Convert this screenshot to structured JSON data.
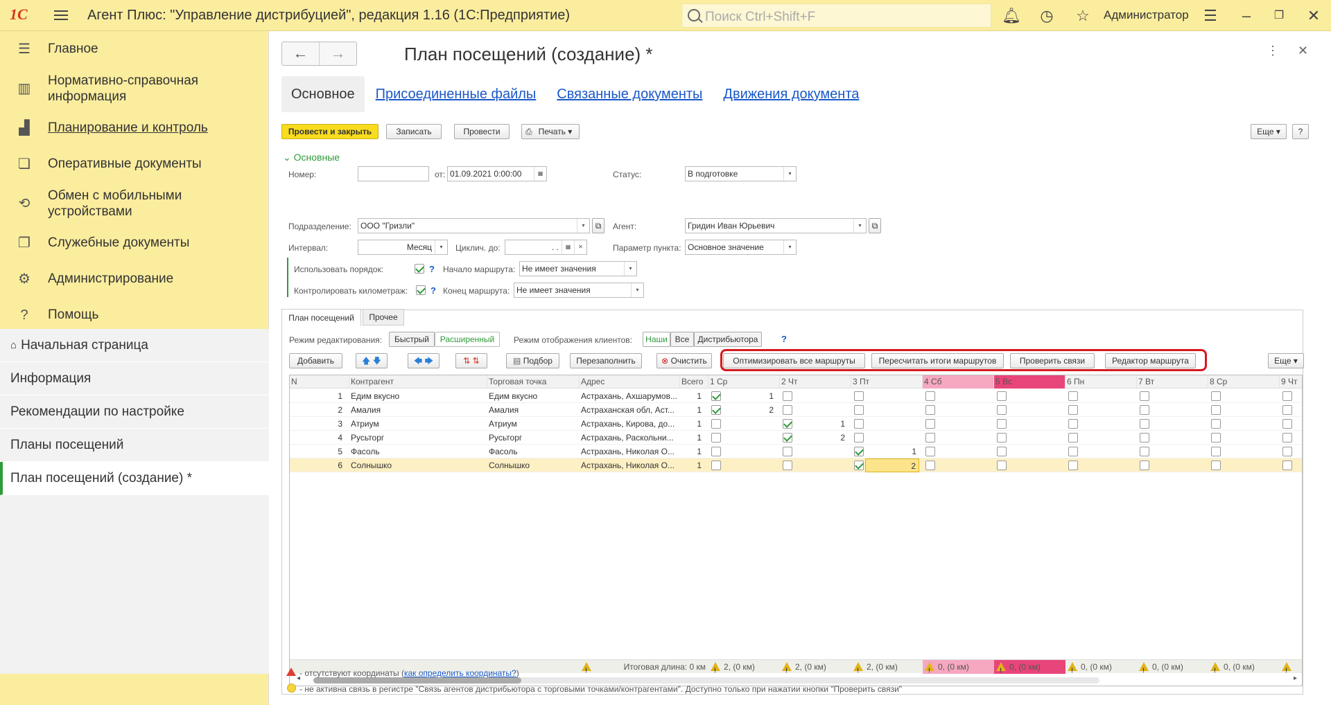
{
  "app": {
    "title": "Агент Плюс: \"Управление дистрибуцией\", редакция 1.16  (1С:Предприятие)",
    "search_placeholder": "Поиск Ctrl+Shift+F",
    "user": "Администратор",
    "logo": "1С"
  },
  "sidebar": {
    "items": [
      {
        "icon": "menu-icon",
        "label": "Главное"
      },
      {
        "icon": "books-icon",
        "label": "Нормативно-справочная информация"
      },
      {
        "icon": "chart-icon",
        "label": "Планирование и контроль"
      },
      {
        "icon": "docs-icon",
        "label": "Оперативные документы"
      },
      {
        "icon": "sync-icon",
        "label": "Обмен с мобильными устройствами"
      },
      {
        "icon": "docs2-icon",
        "label": "Служебные документы"
      },
      {
        "icon": "gear-icon",
        "label": "Администрирование"
      },
      {
        "icon": "help-icon",
        "label": "Помощь"
      }
    ],
    "home": "Начальная страница",
    "open": [
      "Информация",
      "Рекомендации по настройке",
      "Планы посещений",
      "План посещений  (создание) *"
    ]
  },
  "form": {
    "title": "План посещений  (создание) *",
    "tabs": [
      "Основное",
      "Присоединенные файлы",
      "Связанные документы",
      "Движения документа"
    ],
    "toolbar": {
      "post_close": "Провести и закрыть",
      "save": "Записать",
      "post": "Провести",
      "print": "Печать",
      "more": "Еще",
      "help": "?"
    },
    "group": "Основные",
    "fields": {
      "number_label": "Номер:",
      "number": "",
      "from_label": "от:",
      "date": "01.09.2021  0:00:00",
      "status_label": "Статус:",
      "status": "В подготовке",
      "division_label": "Подразделение:",
      "division": "ООО \"Гризли\"",
      "agent_label": "Агент:",
      "agent": "Гридин Иван Юрьевич",
      "interval_label": "Интервал:",
      "interval": "Месяц",
      "cycle_label": "Циклич. до:",
      "cycle": " .  .",
      "point_param_label": "Параметр пункта:",
      "point_param": "Основное значение",
      "use_order_label": "Использовать порядок:",
      "route_start_label": "Начало маршрута:",
      "route_start": "Не имеет значения",
      "control_km_label": "Контролировать километраж:",
      "route_end_label": "Конец маршрута:",
      "route_end": "Не имеет значения"
    },
    "inner_tabs": [
      "План посещений",
      "Прочее"
    ],
    "edit_mode_label": "Режим редактирования:",
    "edit_modes": [
      "Быстрый",
      "Расширенный"
    ],
    "display_mode_label": "Режим отображения клиентов:",
    "display_modes": [
      "Наши",
      "Все",
      "Дистрибьютора"
    ],
    "grid_toolbar": {
      "add": "Добавить",
      "select": "Подбор",
      "refill": "Перезаполнить",
      "clear": "Очистить",
      "optimize": "Оптимизировать все маршруты",
      "recalc": "Пересчитать итоги маршрутов",
      "check": "Проверить связи",
      "editor": "Редактор маршрута",
      "more": "Еще"
    },
    "columns": [
      "N",
      "Контрагент",
      "Торговая точка",
      "Адрес",
      "Всего",
      "1 Ср",
      "2 Чт",
      "3 Пт",
      "4 Сб",
      "5 Вс",
      "6 Пн",
      "7 Вт",
      "8 Ср",
      "9 Чт"
    ],
    "rows": [
      {
        "n": "1",
        "contractor": "Едим вкусно",
        "point": "Едим вкусно",
        "address": "Астрахань, Ахшарумов...",
        "total": "1",
        "day": 0,
        "order": "1"
      },
      {
        "n": "2",
        "contractor": "Амалия",
        "point": "Амалия",
        "address": "Астраханская обл, Аст...",
        "total": "1",
        "day": 0,
        "order": "2"
      },
      {
        "n": "3",
        "contractor": "Атриум",
        "point": "Атриум",
        "address": "Астрахань, Кирова, до...",
        "total": "1",
        "day": 1,
        "order": "1"
      },
      {
        "n": "4",
        "contractor": "Русьторг",
        "point": "Русьторг",
        "address": "Астрахань, Раскольни...",
        "total": "1",
        "day": 1,
        "order": "2"
      },
      {
        "n": "5",
        "contractor": "Фасоль",
        "point": "Фасоль",
        "address": "Астрахань, Николая О...",
        "total": "1",
        "day": 2,
        "order": "1"
      },
      {
        "n": "6",
        "contractor": "Солнышко",
        "point": "Солнышко",
        "address": "Астрахань, Николая О...",
        "total": "1",
        "day": 2,
        "order": "2"
      }
    ],
    "footer": {
      "total": "Итоговая длина: 0 км",
      "days": [
        "2, (0 км)",
        "2, (0 км)",
        "2, (0 км)",
        "0, (0 км)",
        "0, (0 км)",
        "0, (0 км)",
        "0, (0 км)",
        "0, (0 км)",
        ""
      ]
    },
    "notes": {
      "n1_text": "- отсутствуют координаты (",
      "n1_link": "как определить координаты?",
      "n1_end": ")",
      "n2": "- не активна связь в регистре \"Связь агентов дистрибьютора с торговыми точками/контрагентами\". Доступно только при нажатии кнопки \"Проверить связи\""
    }
  },
  "colors": {
    "accent": "#fbed9e",
    "button_yellow": "#f8dc1e",
    "highlight": "#d6181f",
    "weekend_sat": "#f5a8c0",
    "weekend_sun": "#e8457a"
  }
}
